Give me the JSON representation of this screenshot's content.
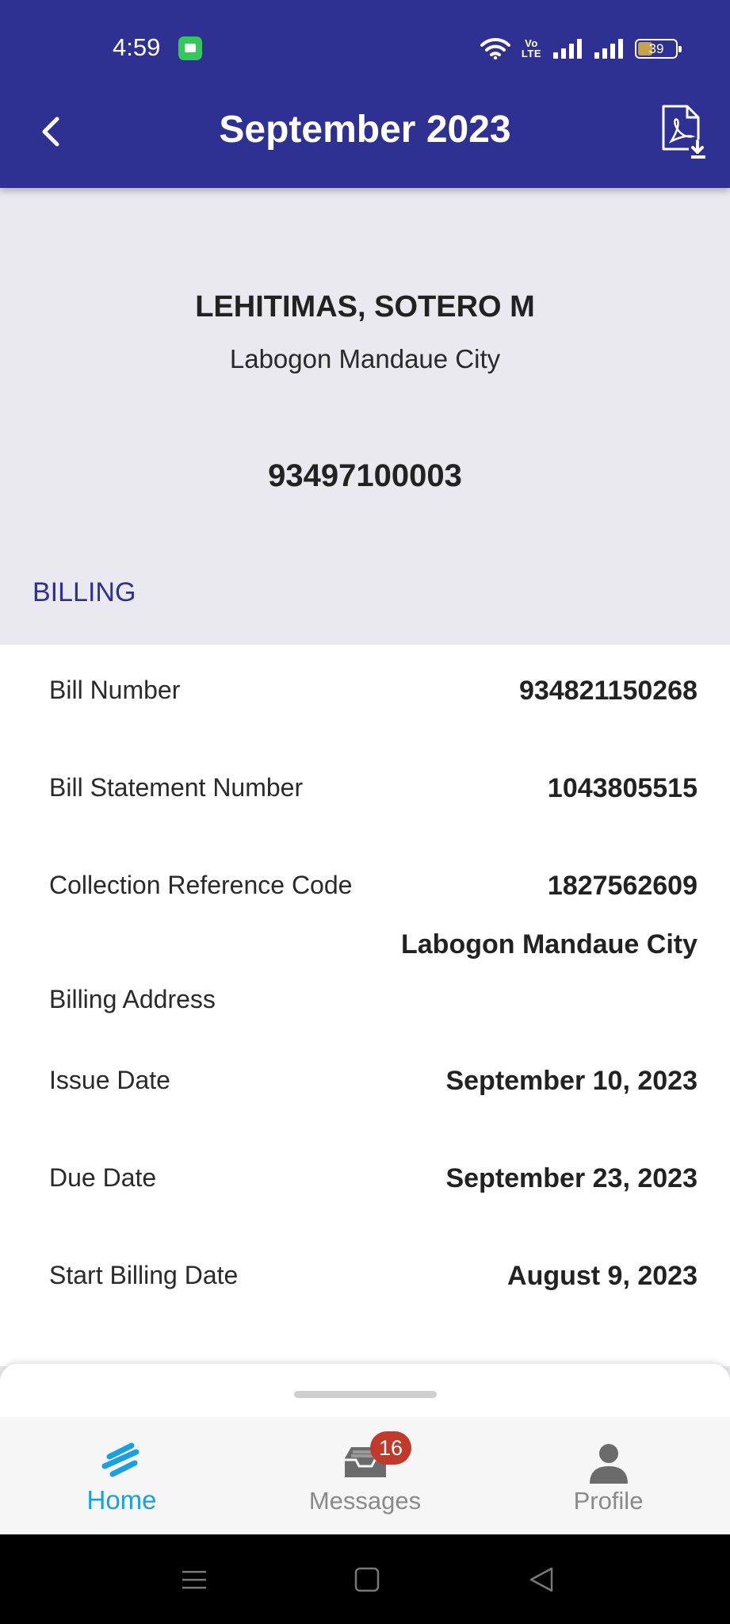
{
  "status_bar": {
    "time": "4:59",
    "network_label_top": "Vo",
    "network_label_bottom": "LTE",
    "battery": "39"
  },
  "header": {
    "title": "September 2023",
    "back_icon": "chevron-left-icon",
    "download_icon": "pdf-download-icon"
  },
  "customer": {
    "name": "LEHITIMAS, SOTERO M",
    "address": "Labogon Mandaue City",
    "account_number": "93497100003"
  },
  "billing": {
    "section_title": "BILLING",
    "rows": [
      {
        "label": "Bill Number",
        "value": "934821150268"
      },
      {
        "label": "Bill Statement Number",
        "value": "1043805515"
      },
      {
        "label": "Collection Reference Code",
        "value": "1827562609"
      },
      {
        "label": "Billing Address",
        "value": "Labogon Mandaue City"
      },
      {
        "label": "Issue Date",
        "value": "September 10, 2023"
      },
      {
        "label": "Due Date",
        "value": "September 23, 2023"
      },
      {
        "label": "Start Billing Date",
        "value": "August 9, 2023"
      }
    ]
  },
  "bottom_nav": {
    "items": [
      {
        "label": "Home",
        "icon": "home-icon",
        "active": true
      },
      {
        "label": "Messages",
        "icon": "inbox-icon",
        "badge": "16"
      },
      {
        "label": "Profile",
        "icon": "person-icon"
      }
    ]
  },
  "colors": {
    "header_bg": "#2e3192",
    "page_bg": "#e9e9ef",
    "accent": "#1aa0e0",
    "badge": "#c0392b"
  }
}
